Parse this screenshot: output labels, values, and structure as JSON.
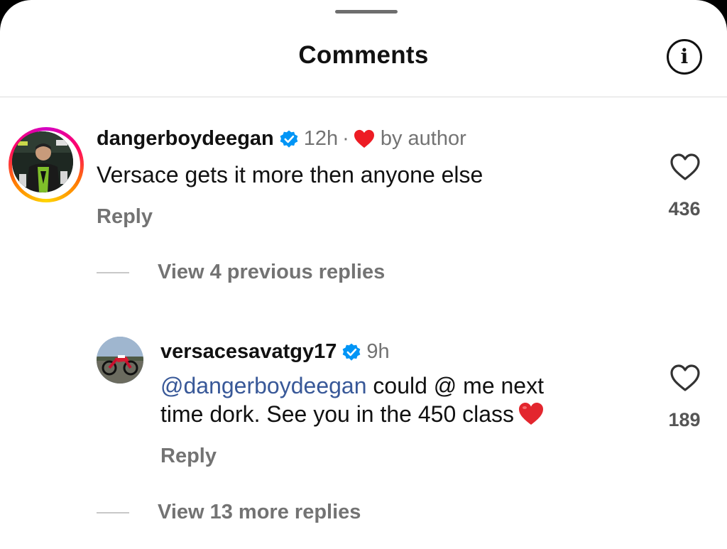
{
  "header": {
    "title": "Comments",
    "info_glyph": "i",
    "info_icon": "info-icon"
  },
  "comments": [
    {
      "username": "dangerboydeegan",
      "verified": true,
      "time": "12h",
      "separator": "·",
      "liked_by_author_label": "by author",
      "text": "Versace gets it more then anyone else",
      "reply_label": "Reply",
      "like_count": "436",
      "story_ring": true
    },
    {
      "username": "versacesavatgy17",
      "verified": true,
      "time": "9h",
      "mention": "@dangerboydeegan",
      "text_after_mention": " could @ me next",
      "text_line2": "time dork. See you in the 450 class",
      "emoji": "red-heart",
      "reply_label": "Reply",
      "like_count": "189"
    }
  ],
  "view_replies": [
    {
      "label": "View 4 previous replies"
    },
    {
      "label": "View 13 more replies"
    }
  ],
  "colors": {
    "verified_blue": "#0095f6",
    "heart_red": "#ed1c24",
    "mention_blue": "#385898",
    "muted": "#737373"
  }
}
